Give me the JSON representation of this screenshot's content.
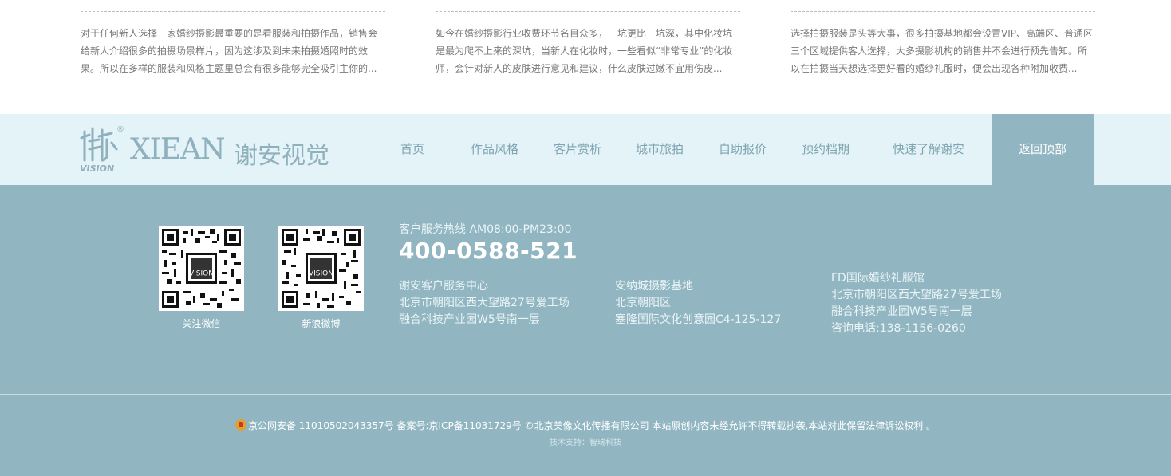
{
  "articles": [
    {
      "text": "对于任何新人选择一家婚纱摄影最重要的是看服装和拍摄作品，销售会给新人介绍很多的拍摄场景样片，因为这涉及到未来拍摄婚照时的效果。所以在多样的服装和风格主题里总会有很多能够完全吸引主你的..."
    },
    {
      "text": "如今在婚纱摄影行业收费环节名目众多，一坑更比一坑深，其中化妆坑是最为爬不上来的深坑，当新人在化妆时，一些看似“非常专业”的化妆师，会针对新人的皮肤进行意见和建议，什么皮肤过嫩不宜用伤皮..."
    },
    {
      "text": "选择拍摄服装是头等大事，很多拍摄基地都会设置VIP、高端区、普通区三个区域提供客人选择，大多摄影机构的销售并不会进行预先告知。所以在拍摄当天想选择更好看的婚纱礼服时，便会出现各种附加收费..."
    }
  ],
  "logo": {
    "registered": "®",
    "brand_en": "XIEAN",
    "brand_cn": "谢安视觉",
    "mark_text": "VISION"
  },
  "nav": {
    "items": [
      "首页",
      "作品风格",
      "客片赏析",
      "城市旅拍",
      "自助报价",
      "预约档期",
      "快速了解谢安"
    ],
    "back_to_top": "返回顶部"
  },
  "footer": {
    "qr_codes": [
      {
        "label": "关注微信",
        "mark_text": "VISION"
      },
      {
        "label": "新浪微博",
        "mark_text": "VISION"
      }
    ],
    "hotline_label": "客户服务热线 AM08:00-PM23:00",
    "hotline": "400-0588-521",
    "addresses": [
      {
        "name": "谢安客户服务中心",
        "line1": "北京市朝阳区西大望路27号爱工场",
        "line2": "融合科技产业园W5号南一层"
      },
      {
        "name": "安纳城摄影基地",
        "line1": "北京朝阳区",
        "line2": "塞隆国际文化创意园C4-125-127"
      },
      {
        "name": "FD国际婚纱礼服馆",
        "line1": "北京市朝阳区西大望路27号爱工场",
        "line2": "融合科技产业园W5号南一层",
        "line3": "咨询电话:138-1156-0260"
      }
    ],
    "copyright": "京公网安备 11010502043357号  备案号:京ICP备11031729号 ©北京美像文化传播有限公司 本站原创内容未经允许不得转载抄袭,本站对此保留法律诉讼权利 。",
    "tech_support": "技术支持：智瑞科技"
  },
  "colors": {
    "nav_bg": "#e3f3f8",
    "footer_bg": "#91b6c2",
    "accent": "#8fb0bd"
  }
}
